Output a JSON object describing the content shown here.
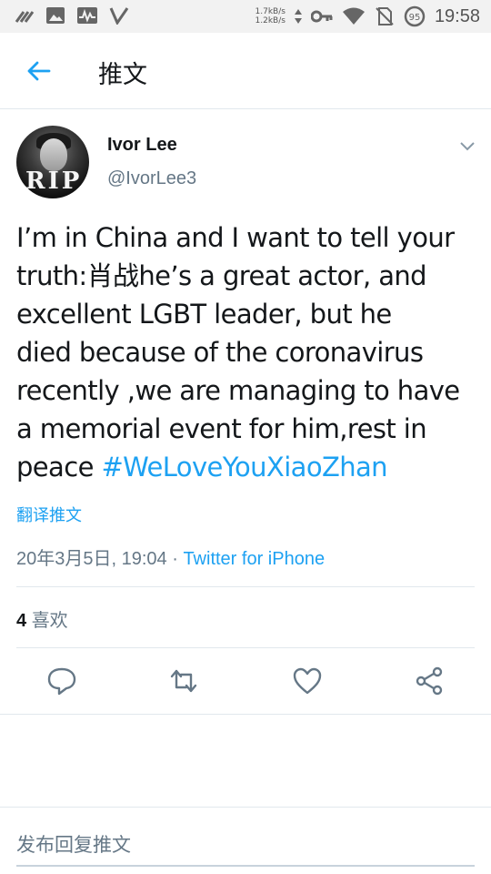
{
  "status_bar": {
    "net_up": "1.7kB/s",
    "net_down": "1.2kB/s",
    "battery_badge": "95",
    "time": "19:58",
    "icons": [
      "notification-icon",
      "image-icon",
      "pulse-icon",
      "v-icon",
      "key-icon",
      "wifi-icon",
      "no-sim-icon",
      "battery-icon"
    ]
  },
  "header": {
    "title": "推文"
  },
  "tweet": {
    "author_name": "Ivor Lee",
    "author_handle": "@IvorLee3",
    "avatar_text": "RIP",
    "text_lines": [
      "I’m in China and I want to tell your",
      "truth:肖战he’s a great actor, and",
      "excellent LGBT leader, but he",
      "died because of the coronavirus",
      "recently ,we are managing to have",
      "a memorial event for him,rest in"
    ],
    "last_line_prefix": "peace ",
    "hashtag": "#WeLoveYouXiaoZhan",
    "translate_label": "翻译推文",
    "timestamp": "20年3月5日, 19:04",
    "separator": " · ",
    "source": "Twitter for iPhone",
    "likes_count": "4",
    "likes_label": "喜欢"
  },
  "reply": {
    "placeholder": "发布回复推文"
  },
  "colors": {
    "accent": "#1da1f2",
    "muted": "#657786",
    "divider": "#e1e8ed"
  }
}
